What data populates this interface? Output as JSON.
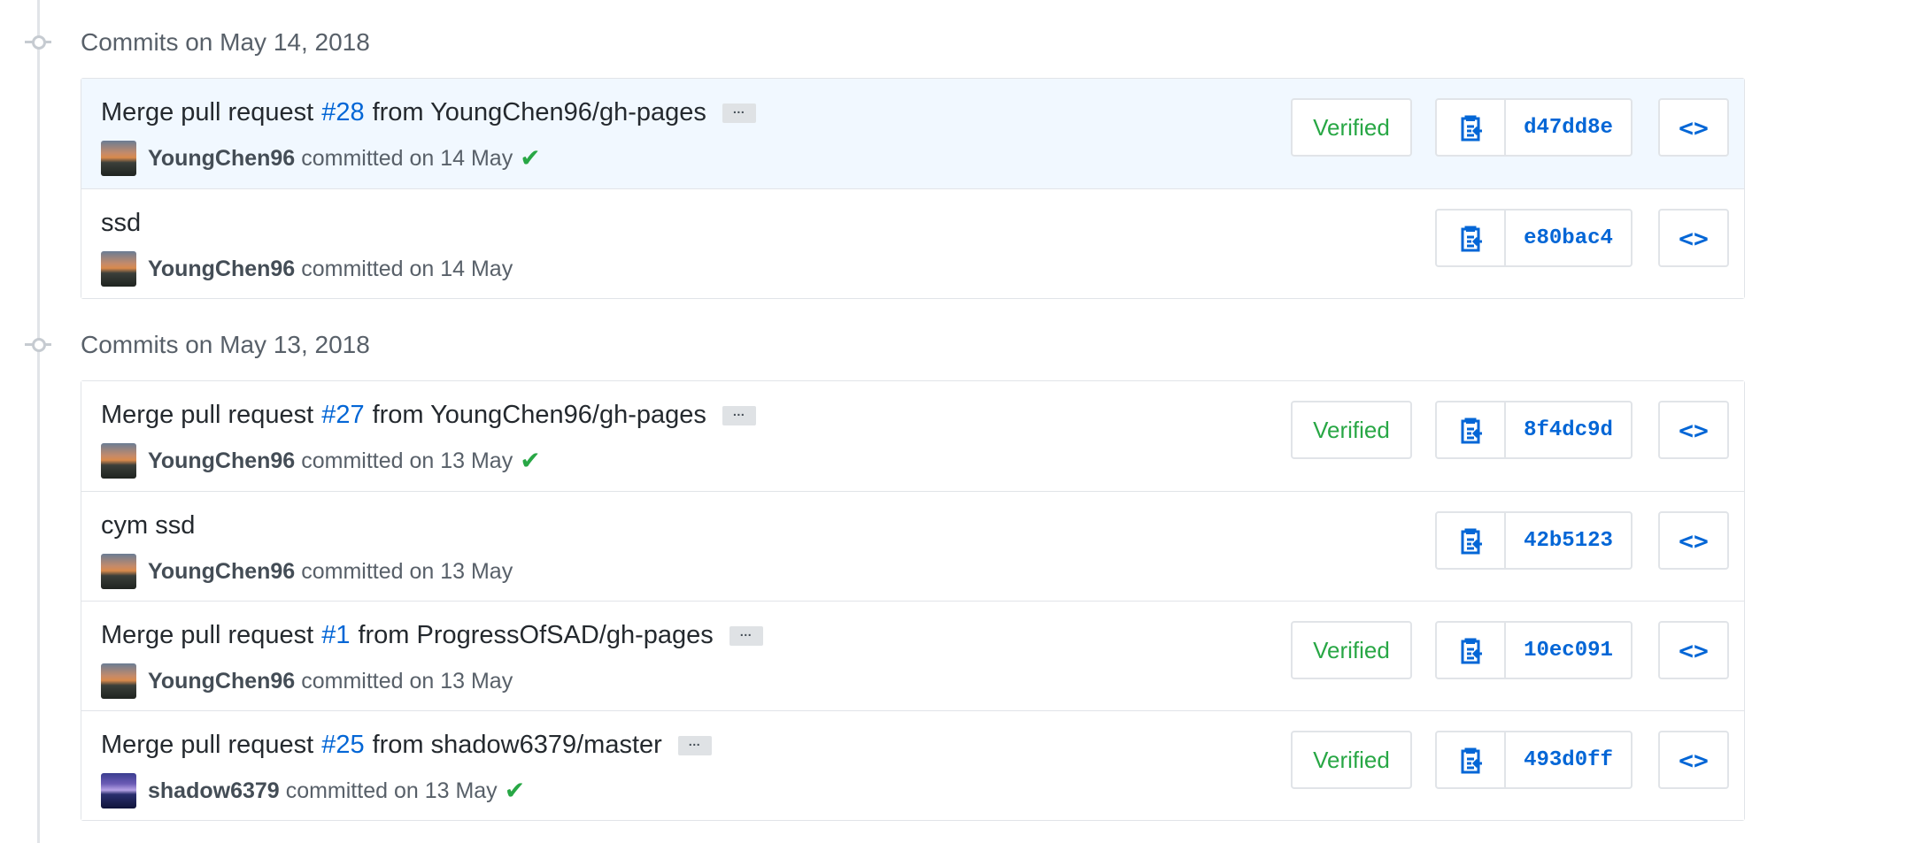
{
  "groups": [
    {
      "title": "Commits on May 14, 2018",
      "commits": [
        {
          "title_prefix": "Merge pull request",
          "pr": "#28",
          "title_suffix": "from YoungChen96/gh-pages",
          "ellipsis": "…",
          "author": "YoungChen96",
          "date_text": "committed on 14 May",
          "check": "✔",
          "verified": "Verified",
          "sha": "d47dd8e",
          "browse": "<>"
        },
        {
          "title_prefix": "ssd",
          "author": "YoungChen96",
          "date_text": "committed on 14 May",
          "sha": "e80bac4",
          "browse": "<>"
        }
      ]
    },
    {
      "title": "Commits on May 13, 2018",
      "commits": [
        {
          "title_prefix": "Merge pull request",
          "pr": "#27",
          "title_suffix": "from YoungChen96/gh-pages",
          "ellipsis": "…",
          "author": "YoungChen96",
          "date_text": "committed on 13 May",
          "check": "✔",
          "verified": "Verified",
          "sha": "8f4dc9d",
          "browse": "<>"
        },
        {
          "title_prefix": "cym ssd",
          "author": "YoungChen96",
          "date_text": "committed on 13 May",
          "sha": "42b5123",
          "browse": "<>"
        },
        {
          "title_prefix": "Merge pull request",
          "pr": "#1",
          "title_suffix": "from ProgressOfSAD/gh-pages",
          "ellipsis": "…",
          "author": "YoungChen96",
          "date_text": "committed on 13 May",
          "verified": "Verified",
          "sha": "10ec091",
          "browse": "<>"
        },
        {
          "title_prefix": "Merge pull request",
          "pr": "#25",
          "title_suffix": "from shadow6379/master",
          "ellipsis": "…",
          "author": "shadow6379",
          "date_text": "committed on 13 May",
          "check": "✔",
          "verified": "Verified",
          "sha": "493d0ff",
          "browse": "<>"
        }
      ]
    }
  ],
  "icons": {
    "copy": "clippy-icon",
    "browse": "code-icon",
    "check": "check-icon",
    "timeline": "git-commit-icon"
  },
  "colors": {
    "link": "#0366d6",
    "verified": "#28a745",
    "highlight": "#f1f8ff"
  }
}
